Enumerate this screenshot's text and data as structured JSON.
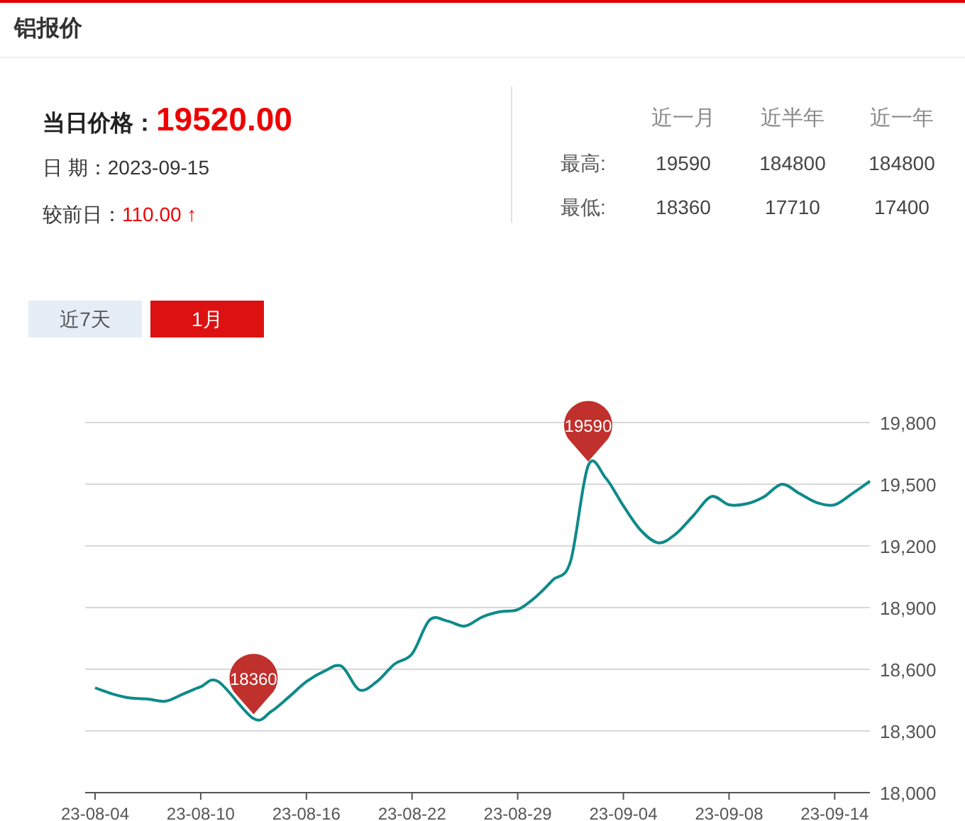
{
  "header": {
    "title": "铝报价"
  },
  "price": {
    "label": "当日价格：",
    "value": "19520.00"
  },
  "date": {
    "label": "日 期：",
    "value": "2023-09-15"
  },
  "change": {
    "label": "较前日：",
    "value": "110.00 ↑"
  },
  "range_table": {
    "columns": [
      "近一月",
      "近半年",
      "近一年"
    ],
    "rows": [
      {
        "label": "最高:",
        "values": [
          "19590",
          "184800",
          "184800"
        ]
      },
      {
        "label": "最低:",
        "values": [
          "18360",
          "17710",
          "17400"
        ]
      }
    ]
  },
  "tabs": [
    {
      "label": "近7天",
      "selected": false
    },
    {
      "label": "1月",
      "selected": true
    }
  ],
  "chart": {
    "chart_data": {
      "type": "line",
      "categories": [
        "23-08-04",
        null,
        null,
        null,
        null,
        null,
        "23-08-10",
        null,
        null,
        null,
        null,
        null,
        "23-08-16",
        null,
        null,
        null,
        null,
        null,
        "23-08-22",
        null,
        null,
        null,
        null,
        null,
        "23-08-29",
        null,
        null,
        null,
        null,
        null,
        "23-09-04",
        null,
        null,
        null,
        null,
        null,
        "23-09-08",
        null,
        null,
        null,
        null,
        null,
        "23-09-14",
        null,
        null
      ],
      "series": [
        {
          "color": "#0e8a8a",
          "values": [
            18510,
            18480,
            18460,
            18455,
            18445,
            18480,
            18515,
            18540,
            null,
            18360,
            18395,
            18465,
            18540,
            18590,
            18615,
            18500,
            18540,
            18625,
            18675,
            18840,
            18835,
            18810,
            18855,
            18880,
            18890,
            18950,
            19035,
            19125,
            19590,
            19530,
            19395,
            19275,
            19215,
            19260,
            19350,
            19440,
            19400,
            19405,
            19440,
            19500,
            19455,
            19410,
            19400,
            19455,
            19515
          ]
        }
      ],
      "ylim": [
        18000,
        19800
      ],
      "grid": true,
      "yticks": [
        {
          "value": 18000,
          "label": "18,000"
        },
        {
          "value": 18300,
          "label": "18,300"
        },
        {
          "value": 18600,
          "label": "18,600"
        },
        {
          "value": 18900,
          "label": "18,900"
        },
        {
          "value": 19200,
          "label": "19,200"
        },
        {
          "value": 19500,
          "label": "19,500"
        },
        {
          "value": 19800,
          "label": "19,800"
        }
      ],
      "annotations": [
        {
          "y": 18360,
          "text": "18360"
        },
        {
          "y": 19590,
          "text": "19590"
        }
      ]
    }
  }
}
